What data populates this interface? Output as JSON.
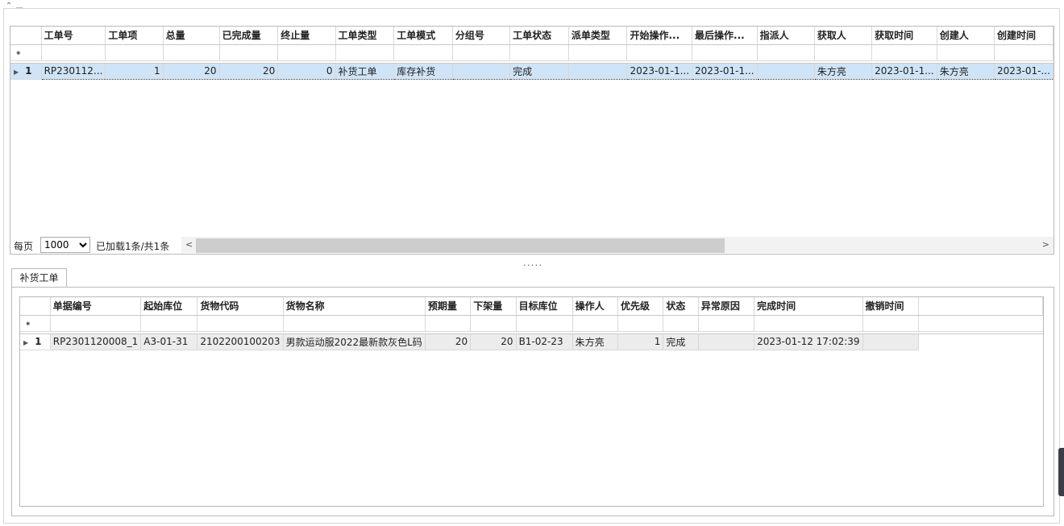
{
  "top_grid": {
    "columns": [
      "工单号",
      "工单项",
      "总量",
      "已完成量",
      "终止量",
      "工单类型",
      "工单模式",
      "分组号",
      "工单状态",
      "派单类型",
      "开始操作...",
      "最后操作...",
      "指派人",
      "获取人",
      "获取时间",
      "创建人",
      "创建时间"
    ],
    "rows": [
      {
        "index": "1",
        "cells": [
          "RP230112...",
          "1",
          "20",
          "20",
          "0",
          "补货工单",
          "库存补货",
          "",
          "完成",
          "",
          "2023-01-1...",
          "2023-01-1...",
          "",
          "朱方亮",
          "2023-01-1...",
          "朱方亮",
          "2023-01-..."
        ]
      }
    ]
  },
  "pager": {
    "per_page_label": "每页",
    "per_page_value": "1000",
    "status_text": "已加载1条/共1条",
    "left_arrow": "<",
    "right_arrow": ">"
  },
  "splitter": {
    "handle": "....."
  },
  "tabs": [
    {
      "label": "补货工单"
    }
  ],
  "detail_grid": {
    "columns": [
      "单据编号",
      "起始库位",
      "货物代码",
      "货物名称",
      "预期量",
      "下架量",
      "目标库位",
      "操作人",
      "优先级",
      "状态",
      "异常原因",
      "完成时间",
      "撤销时间"
    ],
    "rows": [
      {
        "index": "1",
        "cells": [
          "RP2301120008_1",
          "A3-01-31",
          "2102200100203",
          "男款运动服2022最新款灰色L码",
          "20",
          "20",
          "B1-02-23",
          "朱方亮",
          "1",
          "完成",
          "",
          "2023-01-12 17:02:39",
          ""
        ]
      }
    ]
  },
  "icons": {
    "collapse": "chevron-up-icon",
    "filter_row": "pin-icon",
    "row_expand": "triangle-right-icon"
  },
  "colors": {
    "selection": "#cfe4f7",
    "row_grey": "#ececec",
    "scroll_thumb": "#cdcdcd"
  }
}
